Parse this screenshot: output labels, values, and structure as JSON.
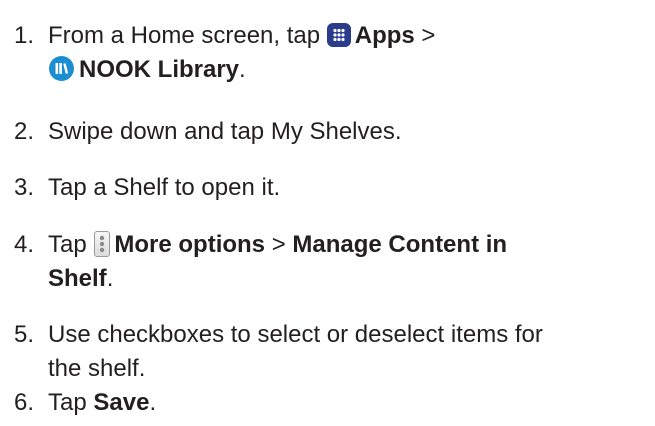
{
  "steps": [
    {
      "number": "1.",
      "line1_text": "From a Home screen, tap ",
      "apps_label": "Apps",
      "sep1": " >",
      "library_label": "NOOK Library",
      "end": "."
    },
    {
      "number": "2.",
      "text": "Swipe down and tap My Shelves."
    },
    {
      "number": "3.",
      "text": "Tap a Shelf to open it."
    },
    {
      "number": "4.",
      "tap_text": "Tap ",
      "more_label": "More options",
      "sep": " > ",
      "manage_label_line1": "Manage Content in",
      "manage_label_line2": "Shelf",
      "end": "."
    },
    {
      "number": "5.",
      "line1": "Use checkboxes to select or deselect items for",
      "line2": "the shelf."
    },
    {
      "number": "6.",
      "tap_text": "Tap ",
      "save_label": "Save",
      "end": "."
    }
  ],
  "icons": {
    "apps": "apps-grid-icon",
    "library": "nook-library-icon",
    "more": "more-options-icon"
  },
  "colors": {
    "text": "#231f20",
    "apps_icon_bg": "#2b3c8c",
    "library_icon_bg": "#1b8ed1"
  }
}
